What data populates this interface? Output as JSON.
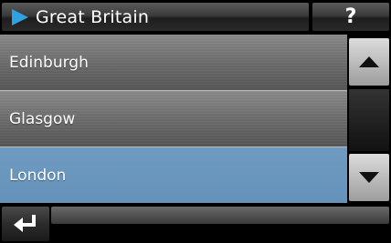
{
  "header": {
    "title": "Great Britain",
    "title_icon": "play-triangle-icon",
    "help_label": "?"
  },
  "list": {
    "items": [
      {
        "label": "Edinburgh",
        "selected": false
      },
      {
        "label": "Glasgow",
        "selected": false
      },
      {
        "label": "London",
        "selected": true
      }
    ]
  },
  "scrollbar": {
    "up_icon": "arrow-up-icon",
    "down_icon": "arrow-down-icon"
  },
  "footer": {
    "back_icon": "return-arrow-icon"
  },
  "colors": {
    "accent_icon": "#2ea3e3",
    "selected_row": "#6592ba",
    "background": "#000000"
  }
}
